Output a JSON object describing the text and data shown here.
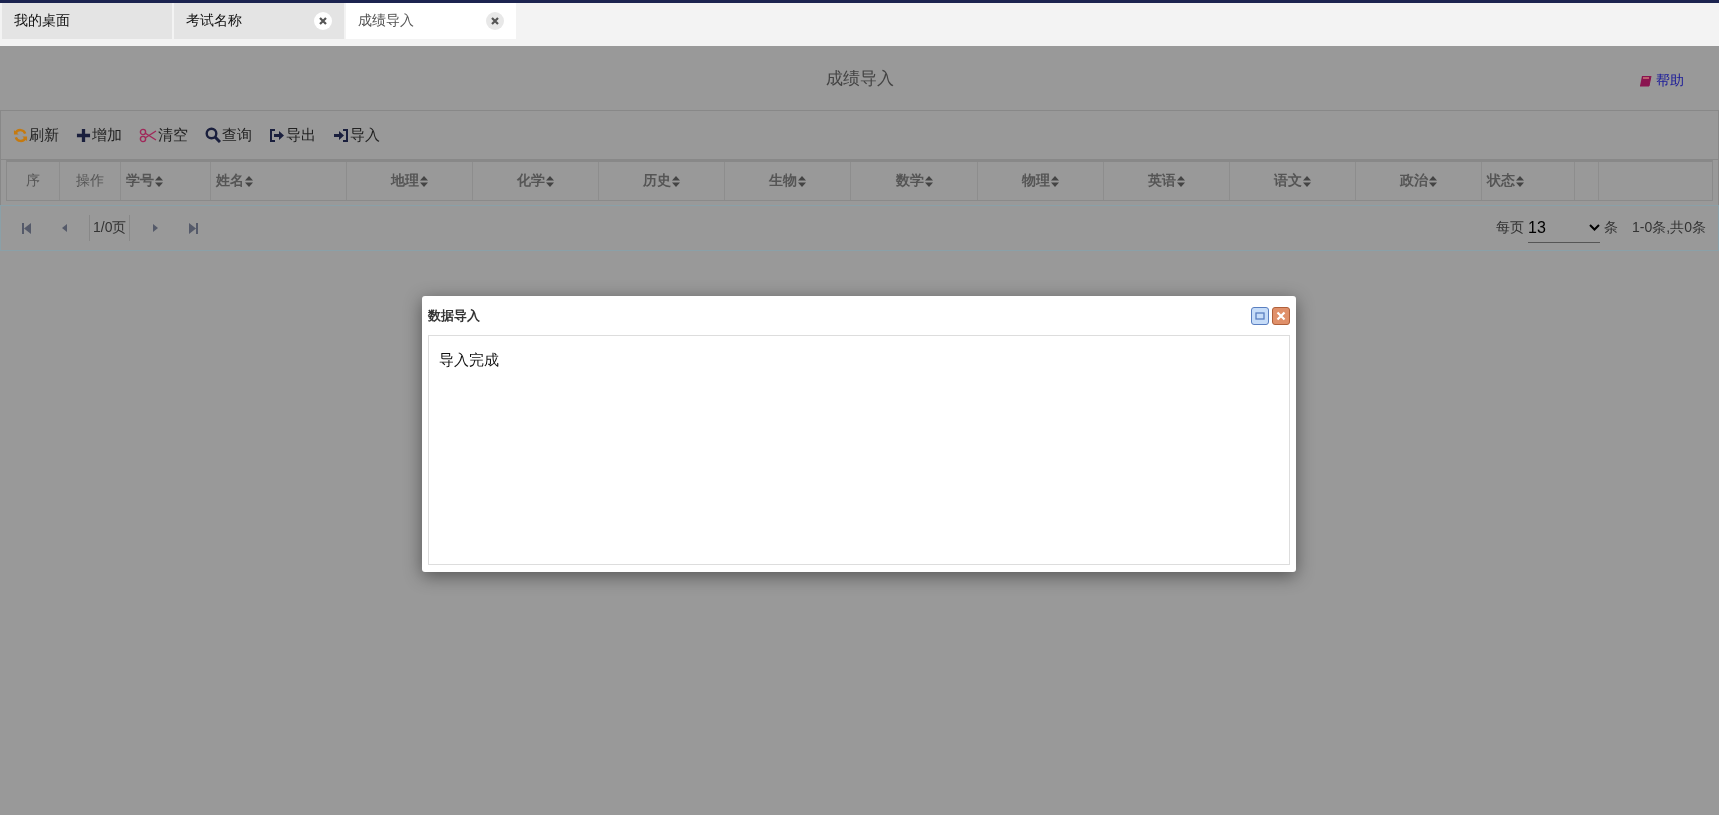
{
  "tabs": [
    {
      "label": "我的桌面",
      "selected": false,
      "closable": false
    },
    {
      "label": "考试名称",
      "selected": false,
      "closable": true
    },
    {
      "label": "成绩导入",
      "selected": true,
      "closable": true
    }
  ],
  "page": {
    "title": "成绩导入",
    "help": "帮助"
  },
  "toolbar": [
    {
      "kind": "refresh",
      "label": "刷新"
    },
    {
      "kind": "add",
      "label": "增加"
    },
    {
      "kind": "clear",
      "label": "清空"
    },
    {
      "kind": "search",
      "label": "查询"
    },
    {
      "kind": "export",
      "label": "导出"
    },
    {
      "kind": "import",
      "label": "导入"
    }
  ],
  "table": {
    "columns": [
      {
        "label": "序",
        "sortable": false
      },
      {
        "label": "操作",
        "sortable": false
      },
      {
        "label": "学号",
        "sortable": true
      },
      {
        "label": "姓名",
        "sortable": true
      },
      {
        "label": "地理",
        "sortable": true
      },
      {
        "label": "化学",
        "sortable": true
      },
      {
        "label": "历史",
        "sortable": true
      },
      {
        "label": "生物",
        "sortable": true
      },
      {
        "label": "数学",
        "sortable": true
      },
      {
        "label": "物理",
        "sortable": true
      },
      {
        "label": "英语",
        "sortable": true
      },
      {
        "label": "语文",
        "sortable": true
      },
      {
        "label": "政治",
        "sortable": true
      },
      {
        "label": "状态",
        "sortable": true
      }
    ]
  },
  "pager": {
    "page_info": "1/0页",
    "per_page_label": "每页",
    "per_page": "13",
    "unit": "条",
    "summary": "1-0条,共0条"
  },
  "dialog": {
    "title": "数据导入",
    "message": "导入完成"
  }
}
